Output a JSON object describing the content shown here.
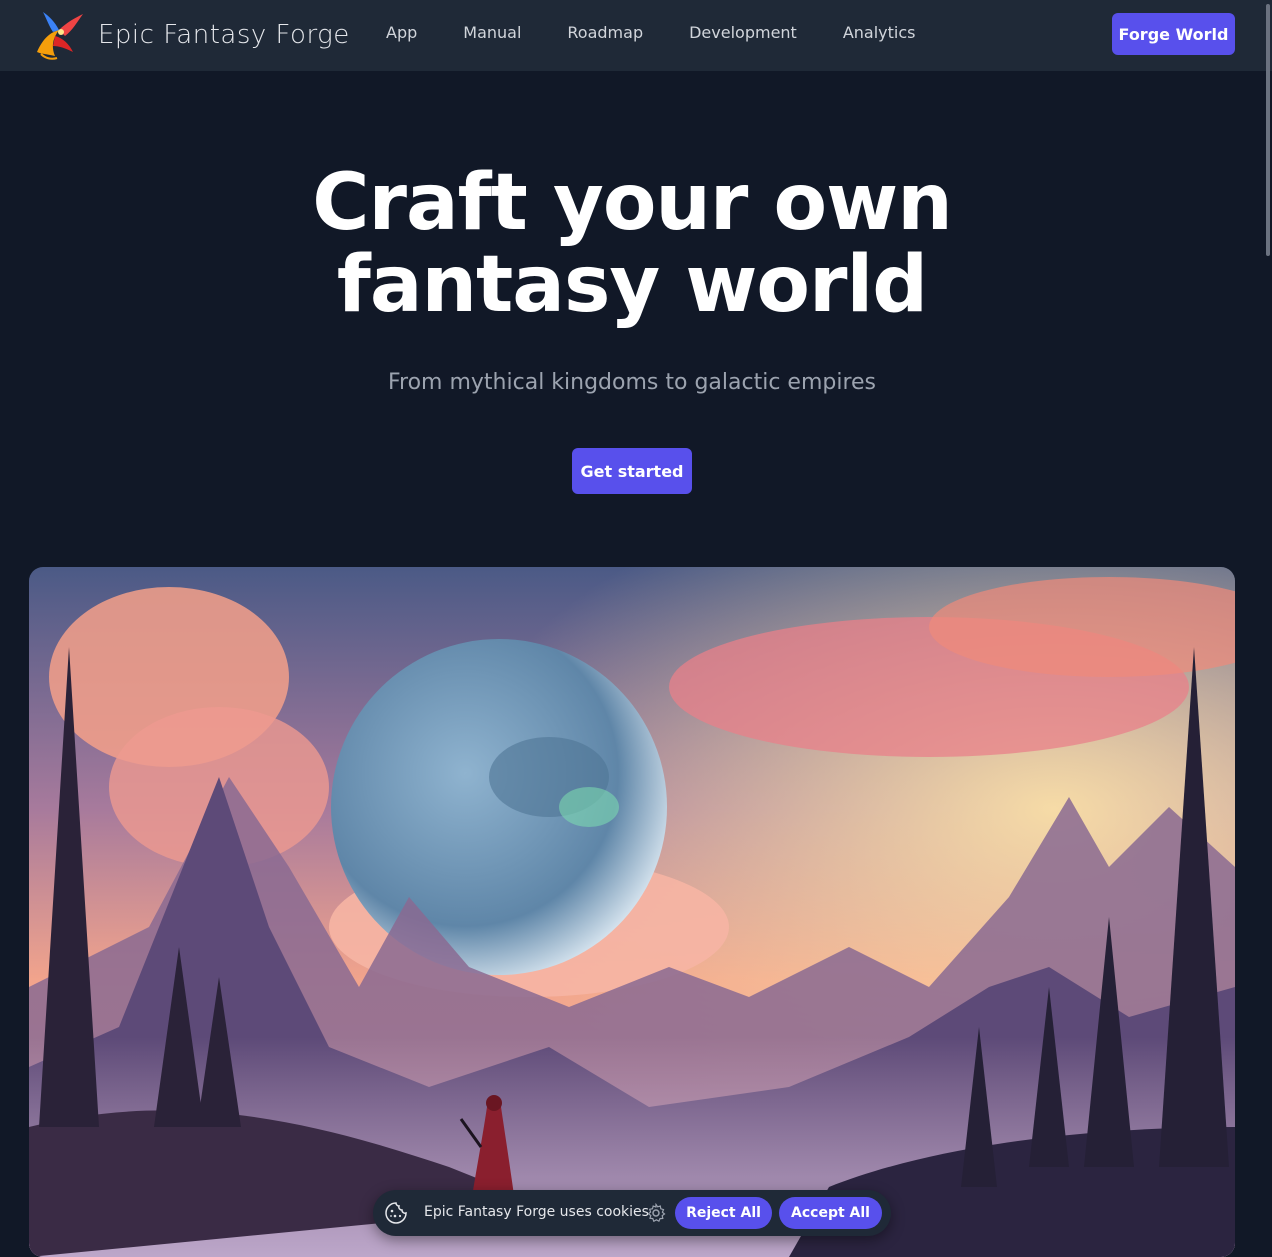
{
  "nav": {
    "brand": "Epic Fantasy Forge",
    "links": [
      "App",
      "Manual",
      "Roadmap",
      "Development",
      "Analytics"
    ],
    "cta": "Forge World"
  },
  "hero": {
    "title_line1": "Craft your own",
    "title_line2": "fantasy world",
    "subtitle": "From mythical kingdoms to galactic empires",
    "cta": "Get started"
  },
  "cookie": {
    "message": "Epic Fantasy Forge uses cookies",
    "reject": "Reject All",
    "accept": "Accept All"
  },
  "colors": {
    "background": "#111827",
    "navbar": "#1f2937",
    "accent": "#5850ec"
  },
  "icons": {
    "logo": "phoenix-logo",
    "cookie": "cookie-icon",
    "settings": "gear-icon"
  }
}
